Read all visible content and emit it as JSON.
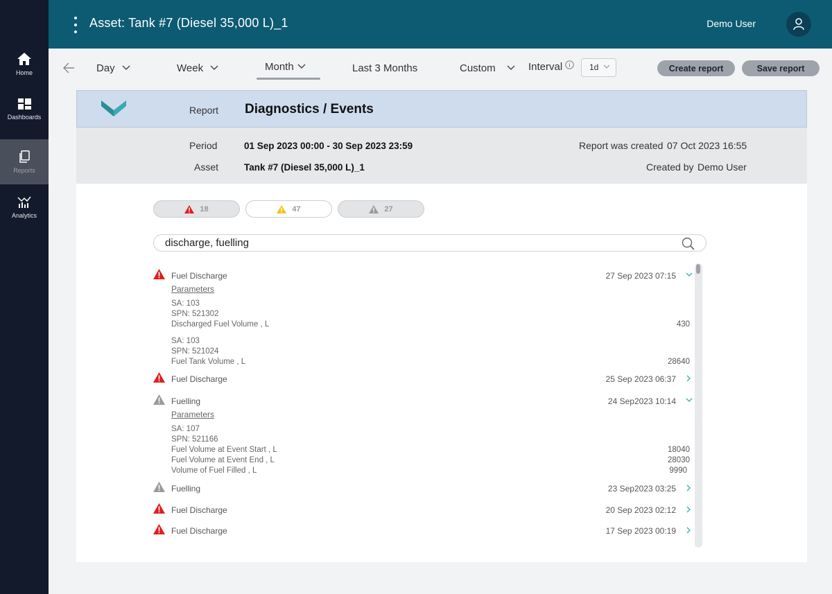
{
  "sidebar": {
    "items": [
      {
        "label": "Home",
        "icon": "home-icon",
        "active": false
      },
      {
        "label": "Dashboards",
        "icon": "dashboards-icon",
        "active": false
      },
      {
        "label": "Reports",
        "icon": "reports-icon",
        "active": true
      },
      {
        "label": "Analytics",
        "icon": "analytics-icon",
        "active": false
      }
    ]
  },
  "header": {
    "title": "Asset:  Tank #7 (Diesel 35,000 L)_1",
    "user": "Demo User"
  },
  "toolbar": {
    "tabs": [
      {
        "label": "Day",
        "has_dropdown": true,
        "active": false
      },
      {
        "label": "Week",
        "has_dropdown": true,
        "active": false
      },
      {
        "label": "Month",
        "has_dropdown": true,
        "active": true
      },
      {
        "label": "Last 3 Months",
        "has_dropdown": false,
        "active": false
      },
      {
        "label": "Custom",
        "has_dropdown": true,
        "active": false
      }
    ],
    "interval_label": "Interval",
    "interval_value": "1d",
    "create_report": "Create report",
    "save_report": "Save report"
  },
  "report": {
    "label": "Report",
    "title": "Diagnostics / Events",
    "period_label": "Period",
    "period_value": "01 Sep 2023 00:00 - 30 Sep 2023 23:59",
    "asset_label": "Asset",
    "asset_value": "Tank #7 (Diesel 35,000 L)_1",
    "created_label": "Report was created",
    "created_value": "07 Oct 2023 16:55",
    "created_by_label": "Created by",
    "created_by_value": "Demo User"
  },
  "filters": [
    {
      "severity": "critical",
      "count": "18",
      "selected": true,
      "color": "#e01e1e"
    },
    {
      "severity": "warning",
      "count": "47",
      "selected": false,
      "color": "#f3c317"
    },
    {
      "severity": "info",
      "count": "27",
      "selected": true,
      "color": "#9a9a9a"
    }
  ],
  "search": {
    "value": "discharge, fuelling"
  },
  "events": [
    {
      "name": "Fuel Discharge",
      "severity": "critical",
      "time": "27 Sep 2023  07:15",
      "expanded": true,
      "params_label": "Parameters",
      "groups": [
        {
          "lines": [
            "SA: 103",
            "SPN: 521302",
            "Discharged Fuel Volume , L"
          ],
          "values": [
            "430"
          ]
        },
        {
          "lines": [
            "SA: 103",
            "SPN: 521024",
            "Fuel Tank Volume  , L"
          ],
          "values": [
            "28640"
          ]
        }
      ]
    },
    {
      "name": "Fuel Discharge",
      "severity": "critical",
      "time": "25 Sep 2023  06:37",
      "expanded": false
    },
    {
      "name": "Fuelling",
      "severity": "info",
      "time": "24 Sep2023   10:14",
      "expanded": true,
      "params_label": "Parameters",
      "groups": [
        {
          "lines": [
            "SA: 107",
            "SPN: 521166",
            "Fuel Volume at Event Start , L",
            "Fuel Volume at Event End , L",
            "Volume of Fuel Filled , L"
          ],
          "values": [
            "18040",
            "28030",
            "9990"
          ]
        }
      ]
    },
    {
      "name": "Fuelling",
      "severity": "info",
      "time": "23 Sep2023   03:25",
      "expanded": false
    },
    {
      "name": "Fuel Discharge",
      "severity": "critical",
      "time": "20 Sep 2023  02:12",
      "expanded": false
    },
    {
      "name": "Fuel Discharge",
      "severity": "critical",
      "time": "17 Sep 2023  00:19",
      "expanded": false
    }
  ],
  "colors": {
    "header_bg": "#0d5b73",
    "sidebar_bg": "#131a2b",
    "report_head_bg": "#cfdcee",
    "accent_teal": "#3aa9b3",
    "critical": "#e01e1e",
    "warning": "#f3c317",
    "info": "#9a9a9a"
  }
}
